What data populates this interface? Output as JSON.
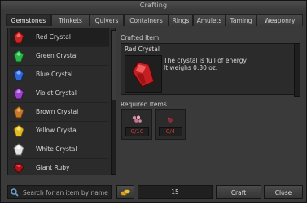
{
  "window": {
    "title": "Crafting"
  },
  "tabs": [
    {
      "label": "Gemstones"
    },
    {
      "label": "Trinkets"
    },
    {
      "label": "Quivers"
    },
    {
      "label": "Containers"
    },
    {
      "label": "Rings"
    },
    {
      "label": "Amulets"
    },
    {
      "label": "Taming"
    },
    {
      "label": "Weaponry"
    }
  ],
  "items": [
    {
      "label": "Red Crystal",
      "color": "#c92626",
      "icon": "red-crystal-icon"
    },
    {
      "label": "Green Crystal",
      "color": "#2bb54a",
      "icon": "green-crystal-icon"
    },
    {
      "label": "Blue Crystal",
      "color": "#2f66d8",
      "icon": "blue-crystal-icon"
    },
    {
      "label": "Violet Crystal",
      "color": "#9a45c9",
      "icon": "violet-crystal-icon"
    },
    {
      "label": "Brown Crystal",
      "color": "#c57a2b",
      "icon": "brown-crystal-icon"
    },
    {
      "label": "Yellow Crystal",
      "color": "#e0bd24",
      "icon": "yellow-crystal-icon"
    },
    {
      "label": "White Crystal",
      "color": "#e3e3e3",
      "icon": "white-crystal-icon"
    },
    {
      "label": "Giant Ruby",
      "color": "#b0121a",
      "icon": "giant-ruby-icon"
    }
  ],
  "crafted": {
    "section_label": "Crafted Item",
    "name": "Red Crystal",
    "description_line1": "The crystal is full of energy",
    "description_line2": "It weighs 0.30 oz."
  },
  "required": {
    "section_label": "Required Items",
    "slots": [
      {
        "count": "0/10",
        "icon": "pink-ore-icon",
        "color": "#d58aa0"
      },
      {
        "count": "0/4",
        "icon": "red-powder-icon",
        "color": "#8a2b3a"
      }
    ]
  },
  "bottom": {
    "search_placeholder": "Search for an item by name",
    "quantity": "15",
    "craft_label": "Craft",
    "close_label": "Close"
  }
}
